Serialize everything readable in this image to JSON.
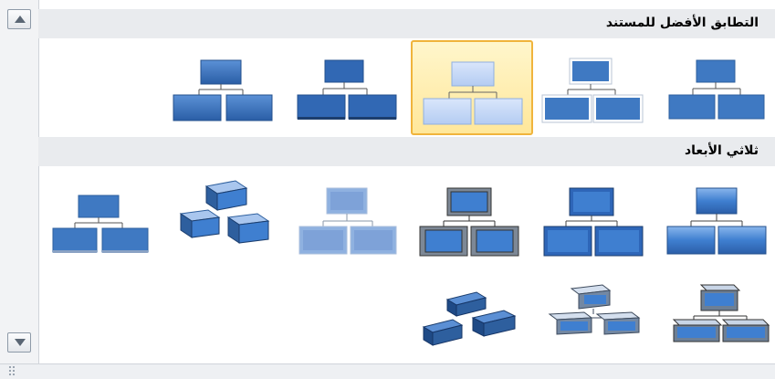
{
  "sections": [
    {
      "title": "التطابق الأفضل للمستند"
    },
    {
      "title": "ثلاثي الأبعاد"
    }
  ],
  "selected_style": "Subtle Effect",
  "icons": {
    "scroll_up": "triangle-up-icon",
    "scroll_down": "triangle-down-icon",
    "resize": "resize-grip-icon"
  },
  "colors": {
    "selection_border": "#f0b43c",
    "section_bg": "#e9ebee",
    "shape_blue": "#3f79c2"
  }
}
